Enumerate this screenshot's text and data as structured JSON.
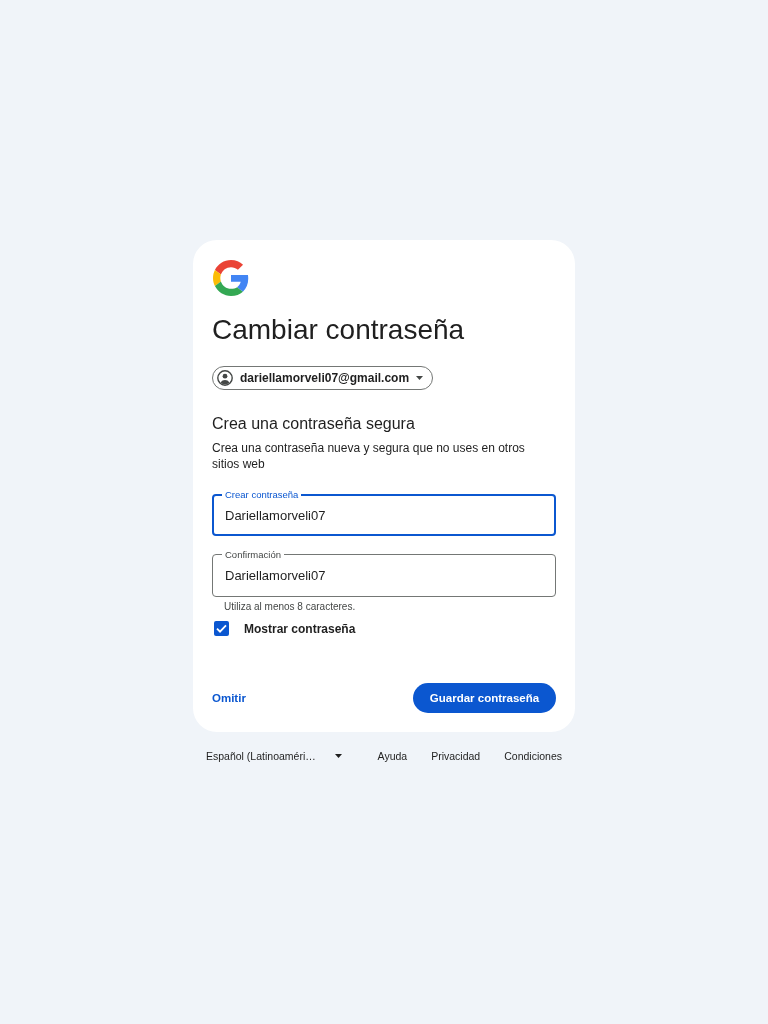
{
  "title": "Cambiar contraseña",
  "account": {
    "email": "dariellamorveli07@gmail.com"
  },
  "section": {
    "heading": "Crea una contraseña segura",
    "description": "Crea una contraseña nueva y segura que no uses en otros sitios web"
  },
  "fields": [
    {
      "label": "Crear contraseña",
      "value": "Dariellamorveli07",
      "focused": true
    },
    {
      "label": "Confirmación",
      "value": "Dariellamorveli07",
      "focused": false,
      "helper": "Utiliza al menos 8 caracteres."
    }
  ],
  "show_password": {
    "label": "Mostrar contraseña",
    "checked": true
  },
  "actions": {
    "skip": "Omitir",
    "save": "Guardar contraseña"
  },
  "footer": {
    "language": "Español (Latinoaméri…",
    "links": [
      "Ayuda",
      "Privacidad",
      "Condiciones"
    ]
  }
}
